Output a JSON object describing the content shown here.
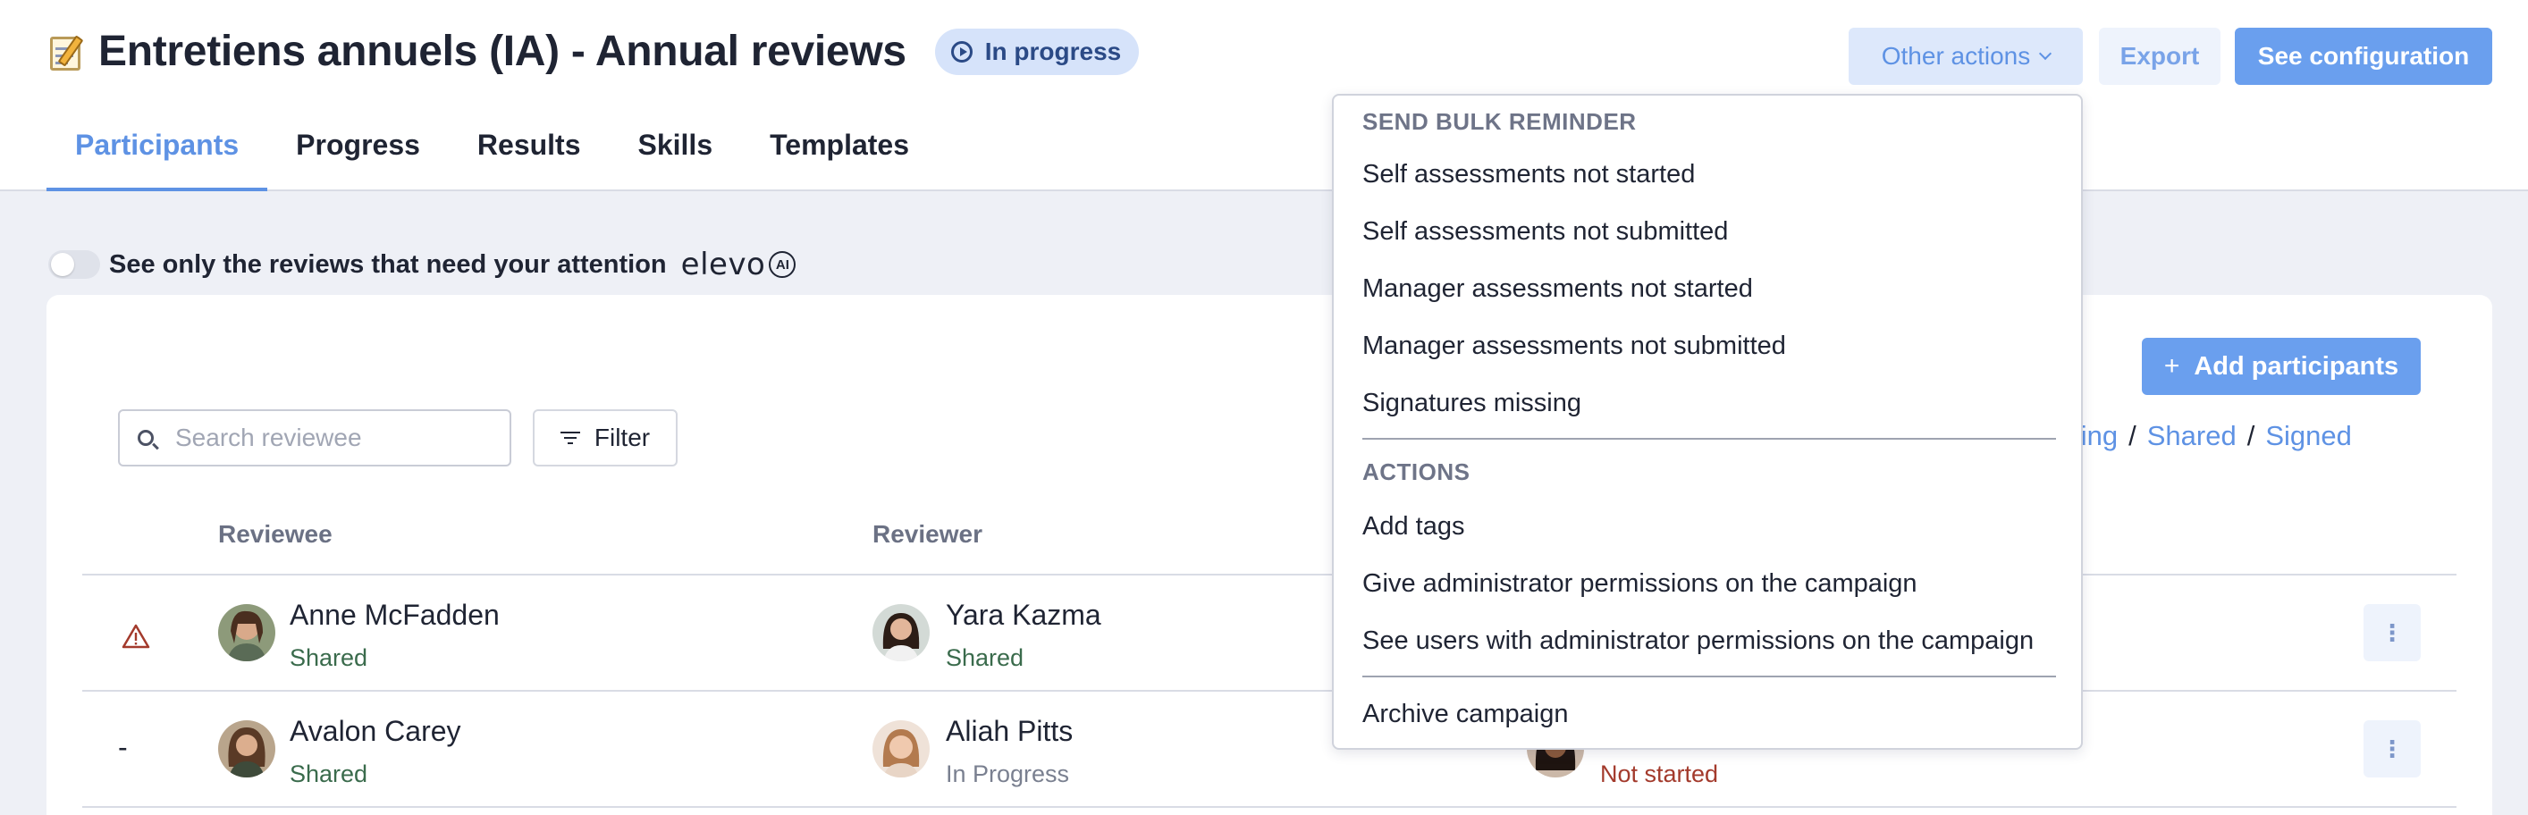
{
  "header": {
    "title": "Entretiens annuels (IA) - Annual reviews",
    "status": "In progress",
    "other_actions_label": "Other actions",
    "export_label": "Export",
    "config_label": "See configuration"
  },
  "tabs": [
    "Participants",
    "Progress",
    "Results",
    "Skills",
    "Templates"
  ],
  "attention_toggle": {
    "label": "See only the reviews that need your attention",
    "brand": "elevo",
    "ai_badge": "AI"
  },
  "toolbar": {
    "search_placeholder": "Search reviewee",
    "filter_label": "Filter",
    "add_label": "Add participants",
    "status_links": [
      "ngoing",
      "Shared",
      "Signed"
    ]
  },
  "table": {
    "columns": [
      "Reviewee",
      "Reviewer"
    ],
    "rows": [
      {
        "indicator": "warning",
        "reviewee": "Anne McFadden",
        "reviewee_status": "Shared",
        "reviewer": "Yara Kazma",
        "reviewer_status": "Shared",
        "third_status": ""
      },
      {
        "indicator": "-",
        "reviewee": "Avalon Carey",
        "reviewee_status": "Shared",
        "reviewer": "Aliah Pitts",
        "reviewer_status": "In Progress",
        "third_status": "Not started"
      }
    ]
  },
  "menu": {
    "section1": "SEND BULK REMINDER",
    "items1": [
      "Self assessments not started",
      "Self assessments not submitted",
      "Manager assessments not started",
      "Manager assessments not submitted",
      "Signatures missing"
    ],
    "section2": "ACTIONS",
    "items2": [
      "Add tags",
      "Give administrator permissions on the campaign",
      "See users with administrator permissions on the campaign"
    ],
    "archive": "Archive campaign"
  },
  "colors": {
    "accent": "#5e92e4",
    "primary_button": "#6a9fee",
    "status_pill_bg": "#d6e3fa",
    "shared": "#3a6b4c",
    "not_started": "#a33a2c",
    "page_bg": "#eef0f6"
  },
  "icons": [
    "memo-icon",
    "play-circle-icon",
    "chevron-down-icon",
    "search-icon",
    "filter-icon",
    "plus-icon",
    "warning-icon",
    "kebab-icon"
  ]
}
